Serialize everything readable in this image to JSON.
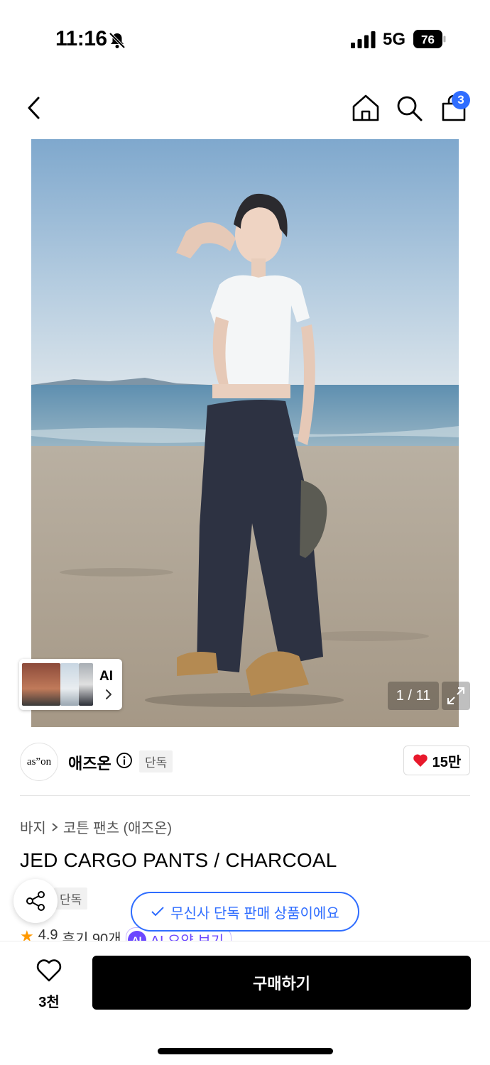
{
  "status_bar": {
    "time": "11:16",
    "network": "5G",
    "battery": "76",
    "icons": [
      "bell-slash-icon",
      "signal-icon",
      "battery-icon"
    ]
  },
  "nav": {
    "icons": [
      "back-icon",
      "home-icon",
      "search-icon",
      "bag-icon"
    ],
    "cart_count": "3"
  },
  "gallery": {
    "ai_label": "AI",
    "counter": "1 / 11",
    "icons": [
      "chevron-right-icon",
      "expand-icon"
    ]
  },
  "brand": {
    "logo_text": "as”on",
    "name": "애즈온",
    "exclusive_tag": "단독",
    "likes": "15만"
  },
  "breadcrumb": {
    "category": "바지",
    "subcategory": "코튼 팬츠 (애즈온)"
  },
  "product": {
    "title": "JED CARGO PANTS / CHARCOAL",
    "exclusive_tag": "단독",
    "rating": "4.9",
    "reviews": "후기 90개",
    "ai_summary": "AI 요약 보기",
    "ai_badge": "AI"
  },
  "toast": {
    "message": "무신사 단독 판매 상품이에요"
  },
  "bottom_bar": {
    "wishlist_count": "3천",
    "buy_label": "구매하기"
  },
  "colors": {
    "accent_blue": "#2f6dff",
    "heart_red": "#e8192c",
    "ai_purple": "#6b47ff",
    "buy_button": "#000000"
  }
}
